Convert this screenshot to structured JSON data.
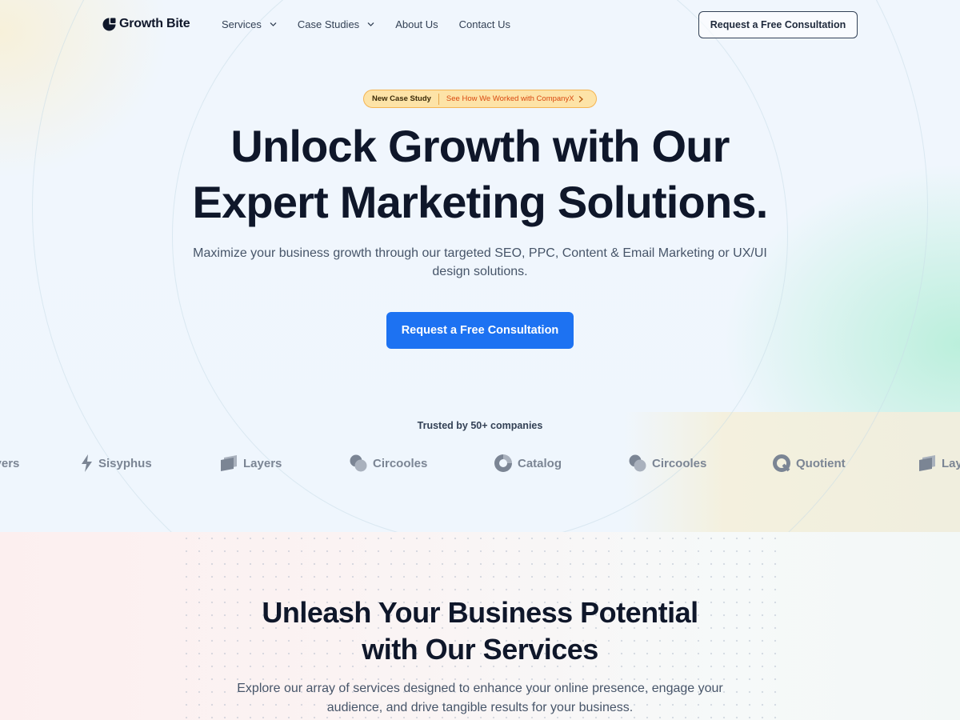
{
  "brand": {
    "name": "Growth Bite"
  },
  "nav": {
    "items": [
      {
        "label": "Services",
        "dropdown": true
      },
      {
        "label": "Case Studies",
        "dropdown": true
      },
      {
        "label": "About Us",
        "dropdown": false
      },
      {
        "label": "Contact Us",
        "dropdown": false
      }
    ],
    "cta": "Request a Free Consultation"
  },
  "hero": {
    "badge_tag": "New Case Study",
    "badge_link": "See How We Worked with CompanyX",
    "title_line1": "Unlock Growth with Our",
    "title_line2": "Expert Marketing Solutions.",
    "subtitle": "Maximize your business growth through our targeted SEO, PPC, Content & Email Marketing or UX/UI design solutions.",
    "cta": "Request a Free Consultation"
  },
  "trusted": {
    "label": "Trusted by 50+ companies",
    "logos": [
      {
        "name": "Layers",
        "icon": "layers-icon"
      },
      {
        "name": "Sisyphus",
        "icon": "bolt-icon"
      },
      {
        "name": "Layers",
        "icon": "layers-icon"
      },
      {
        "name": "Circooles",
        "icon": "circles-icon"
      },
      {
        "name": "Catalog",
        "icon": "catalog-icon"
      },
      {
        "name": "Circooles",
        "icon": "circles-icon"
      },
      {
        "name": "Quotient",
        "icon": "quotient-icon"
      },
      {
        "name": "Layers",
        "icon": "layers-icon"
      }
    ]
  },
  "services": {
    "title_line1": "Unleash Your Business Potential",
    "title_line2": "with Our Services",
    "subtitle": "Explore our array of services designed to enhance your online presence, engage your audience, and drive tangible results for your business."
  },
  "colors": {
    "primary": "#1d72f2",
    "badge_bg": "#fde3a7",
    "badge_link": "#d9480f",
    "text_dark": "#0f172a"
  }
}
